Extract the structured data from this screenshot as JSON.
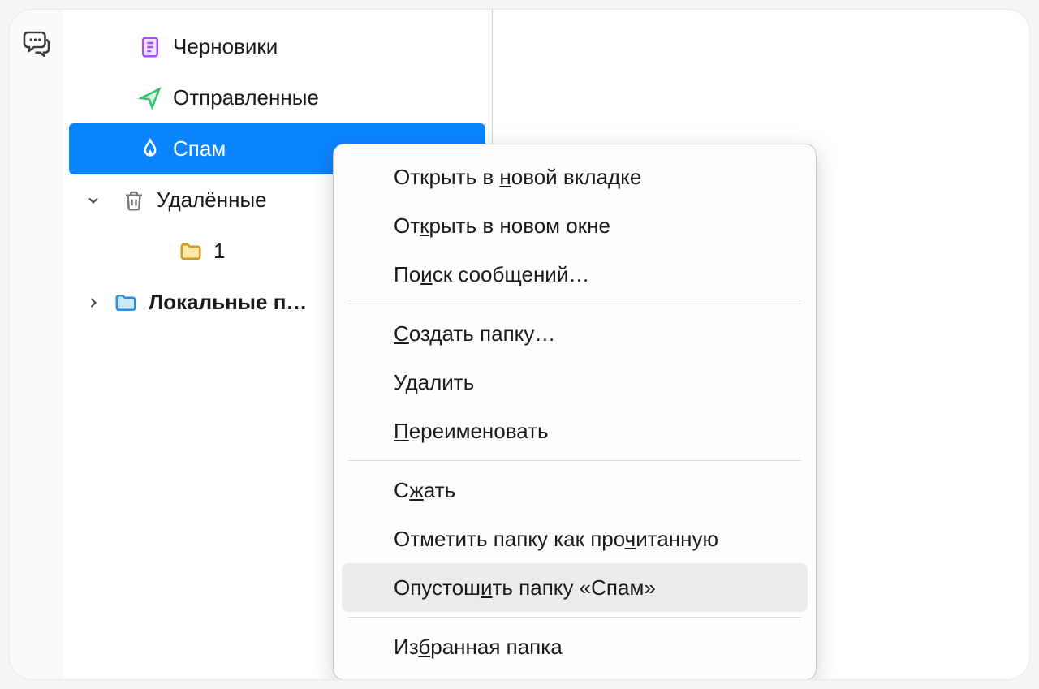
{
  "rail": {
    "chat_icon": "chat-icon"
  },
  "folders": {
    "drafts": "Черновики",
    "sent": "Отправленные",
    "spam": "Спам",
    "trash": "Удалённые",
    "subfolder1": "1",
    "local": "Локальные п…"
  },
  "context_menu": {
    "open_new_tab_pre": "Открыть в ",
    "open_new_tab_u": "н",
    "open_new_tab_post": "овой вкладке",
    "open_new_window_pre": "От",
    "open_new_window_u": "к",
    "open_new_window_post": "рыть в новом окне",
    "search_msgs_pre": "По",
    "search_msgs_u": "и",
    "search_msgs_post": "ск сообщений…",
    "create_folder_pre": "",
    "create_folder_u": "С",
    "create_folder_post": "оздать папку…",
    "delete": "Удалить",
    "rename_pre": "",
    "rename_u": "П",
    "rename_post": "ереименовать",
    "compact_pre": "С",
    "compact_u": "ж",
    "compact_post": "ать",
    "mark_read_pre": "Отметить папку как про",
    "mark_read_u": "ч",
    "mark_read_post": "итанную",
    "empty_spam_pre": "Опустош",
    "empty_spam_u": "и",
    "empty_spam_post": "ть папку «Спам»",
    "favorite_pre": "Из",
    "favorite_u": "б",
    "favorite_post": "ранная папка"
  },
  "colors": {
    "selected_bg": "#0a84ff",
    "hover_bg": "#ececec",
    "drafts_icon": "#a64cff",
    "sent_icon": "#2fc46b",
    "spam_icon": "#ffffff",
    "trash_icon": "#7a7a7a",
    "folder_icon": "#e8b94b",
    "local_folder_icon": "#5ab0ff"
  }
}
